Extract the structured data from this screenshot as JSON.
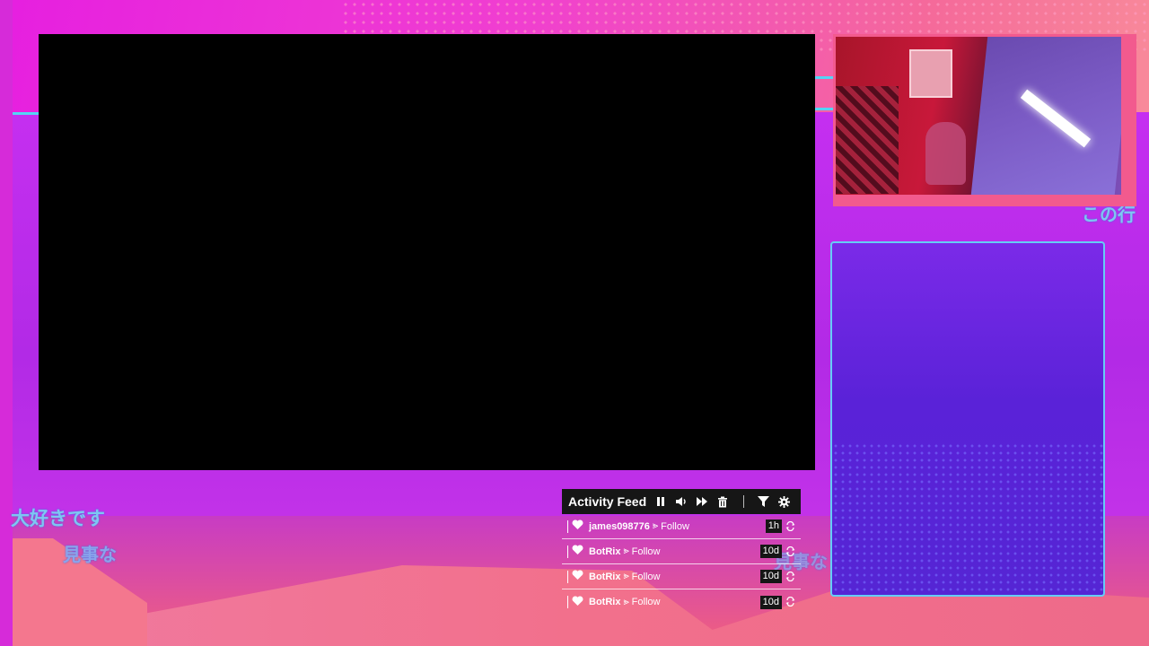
{
  "overlay": {
    "jp_text_left_top": "大好きです",
    "jp_text_left_bottom": "見事な",
    "jp_text_center": "見事な",
    "jp_text_right": "この行"
  },
  "activity_feed": {
    "title": "Activity Feed",
    "controls": [
      "pause-icon",
      "volume-icon",
      "skip-icon",
      "trash-icon",
      "filter-icon",
      "gear-icon"
    ],
    "items": [
      {
        "user": "james098776",
        "arrow": "⪢",
        "action": "Follow",
        "time": "1h"
      },
      {
        "user": "BotRix",
        "arrow": "⪢",
        "action": "Follow",
        "time": "10d"
      },
      {
        "user": "BotRix",
        "arrow": "⪢",
        "action": "Follow",
        "time": "10d"
      },
      {
        "user": "BotRix",
        "arrow": "⪢",
        "action": "Follow",
        "time": "10d"
      }
    ]
  },
  "colors": {
    "accent_cyan": "#65cdf5",
    "panel_purple": "#5a22d8",
    "magenta": "#c02ee8",
    "feed_bg": "#161616"
  }
}
